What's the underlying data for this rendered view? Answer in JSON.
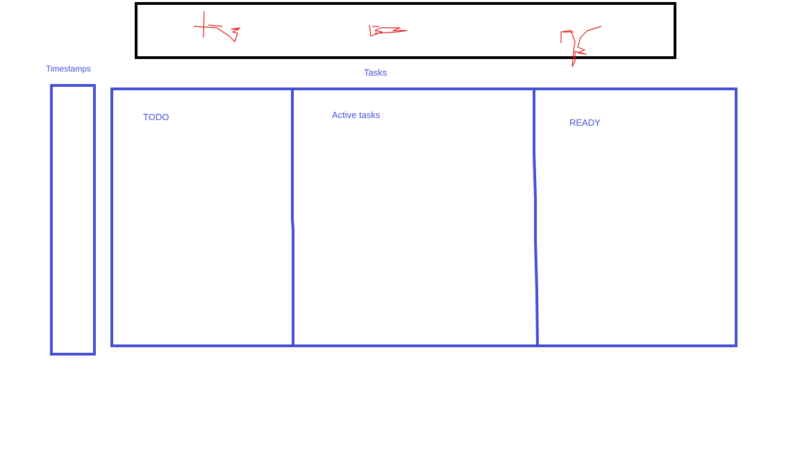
{
  "labels": {
    "timestamps": "Timestamps",
    "tasks": "Tasks",
    "todo": "TODO",
    "active_tasks": "Active tasks",
    "ready": "READY"
  },
  "colors": {
    "diagram_blue": "#4550d6",
    "header_black": "#000000",
    "scribble_red": "#e02020"
  },
  "icons": [
    "red-scribble-icon"
  ]
}
